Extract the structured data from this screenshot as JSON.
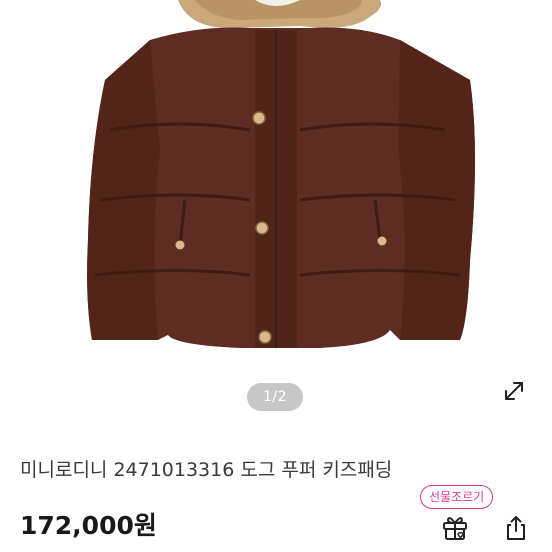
{
  "gallery": {
    "page_indicator": "1/2",
    "current_page": 1,
    "total_pages": 2,
    "image_subject": "brown kids puffer jacket with teddy collar"
  },
  "icons": {
    "expand": "expand-icon",
    "gift": "gift-icon",
    "share": "share-icon"
  },
  "product": {
    "title": "미니로디니 2471013316 도그 푸퍼 키즈패딩",
    "price": "172,000원"
  },
  "gift_badge": {
    "label": "선물조르기"
  },
  "colors": {
    "accent_pink": "#e4398f",
    "jacket_brown": "#5e2c22",
    "collar_tan": "#c9a97a"
  }
}
